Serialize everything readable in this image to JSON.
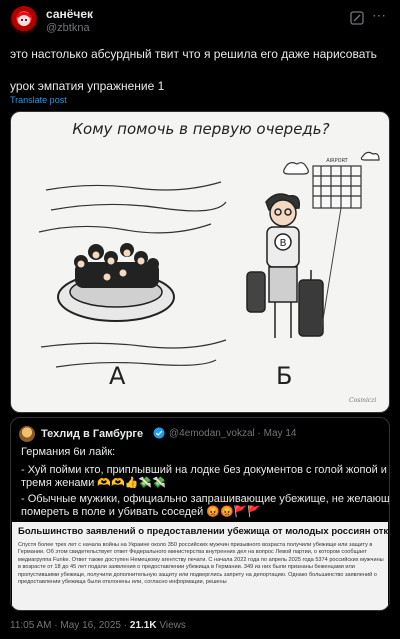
{
  "author": {
    "name": "санёчек",
    "handle": "@zbtkna",
    "avatar_icon": "red-anime-avatar"
  },
  "tweet": {
    "line1": "это настолько абсурдный твит что я решила его даже нарисовать",
    "line2": "урок эмпатия упражнение 1",
    "translate_label": "Translate post"
  },
  "drawing": {
    "title": "Кому помочь в первую очередь?",
    "label_a": "А",
    "label_b": "Б",
    "shirt_letter": "B",
    "sign": "AIRPORT",
    "signature": "Cosmiczi"
  },
  "quote": {
    "name": "Техлид в Гамбурге",
    "handle_date": "@4emodan_vokzal · May 14",
    "text1": "Германия 6и лайк:",
    "text2": "- Хуй пойми кто, приплывший на лодке без документов с голой жопой и",
    "text3": "тремя женами 🫶🫶👍💸💸",
    "text4": "- Обычные мужики, официально запрашивающие убежище, не желающие",
    "text5": "помереть в поле и убивать соседей 😡😡🚩🚩",
    "article_title": "Большинство заявлений о предоставлении убежища от молодых россиян отклонены",
    "article_body": "Спустя более трех лет с начала войны на Украине около 350 российских мужчин призывного возраста получили убежище или защиту в Германии. Об этом свидетельствует ответ Федерального министерства внутренних дел на вопрос Левой партии, о котором сообщает медиагруппа Funke. Ответ также доступен Немецкому агентству печати. С начала 2022 года по апрель 2025 года 5374 российских мужчины в возрасте от 18 до 45 лет подали заявления о предоставлении убежища в Германии. 349 из них были признаны беженцами или пропустившими убежище, получили дополнительную защиту или подверглись запрету на депортацию. Однако большинство заявлений о предоставлении убежища были отклонены или, согласно информации, решены"
  },
  "meta": {
    "time_date": "11:05 AM · May 16, 2025 · ",
    "views_count": "21.1K",
    "views_label": " Views"
  }
}
